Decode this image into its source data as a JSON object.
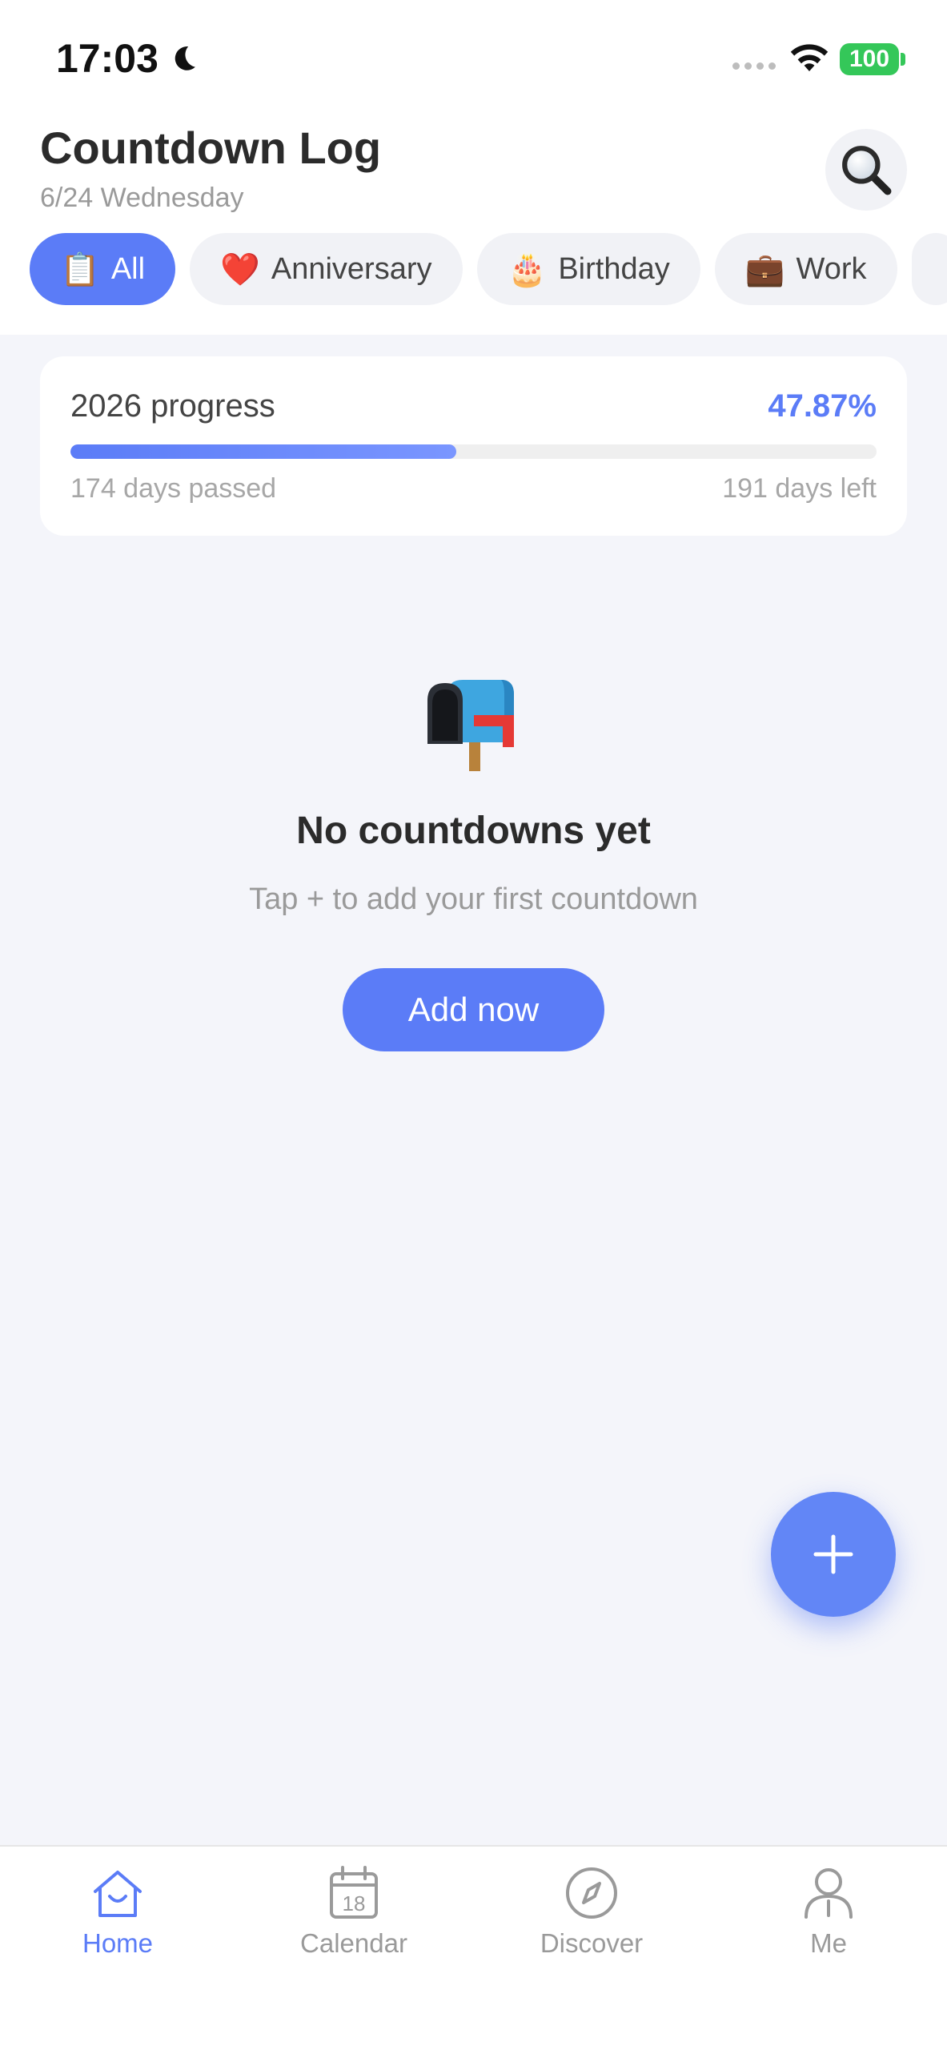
{
  "status_bar": {
    "time": "17:03",
    "battery": "100"
  },
  "header": {
    "title": "Countdown Log",
    "date": "6/24 Wednesday",
    "search_icon": "magnifier-icon"
  },
  "categories": [
    {
      "emoji": "📋",
      "label": "All",
      "active": true
    },
    {
      "emoji": "❤️",
      "label": "Anniversary",
      "active": false
    },
    {
      "emoji": "🎂",
      "label": "Birthday",
      "active": false
    },
    {
      "emoji": "💼",
      "label": "Work",
      "active": false
    }
  ],
  "year_progress": {
    "label": "2026 progress",
    "percent_text": "47.87%",
    "percent_value": 0.4787,
    "passed": "174 days passed",
    "left": "191 days left"
  },
  "empty_state": {
    "icon": "mailbox-icon",
    "title": "No countdowns yet",
    "subtitle": "Tap + to add your first countdown",
    "button": "Add now"
  },
  "fab": {
    "icon": "plus-icon"
  },
  "bottom_nav": [
    {
      "label": "Home",
      "icon": "home-icon",
      "active": true
    },
    {
      "label": "Calendar",
      "icon": "calendar-icon",
      "active": false,
      "calendar_day": "18"
    },
    {
      "label": "Discover",
      "icon": "compass-icon",
      "active": false
    },
    {
      "label": "Me",
      "icon": "person-icon",
      "active": false
    }
  ],
  "colors": {
    "accent": "#5b7cf7",
    "battery": "#34c759",
    "background": "#f4f5fa"
  }
}
